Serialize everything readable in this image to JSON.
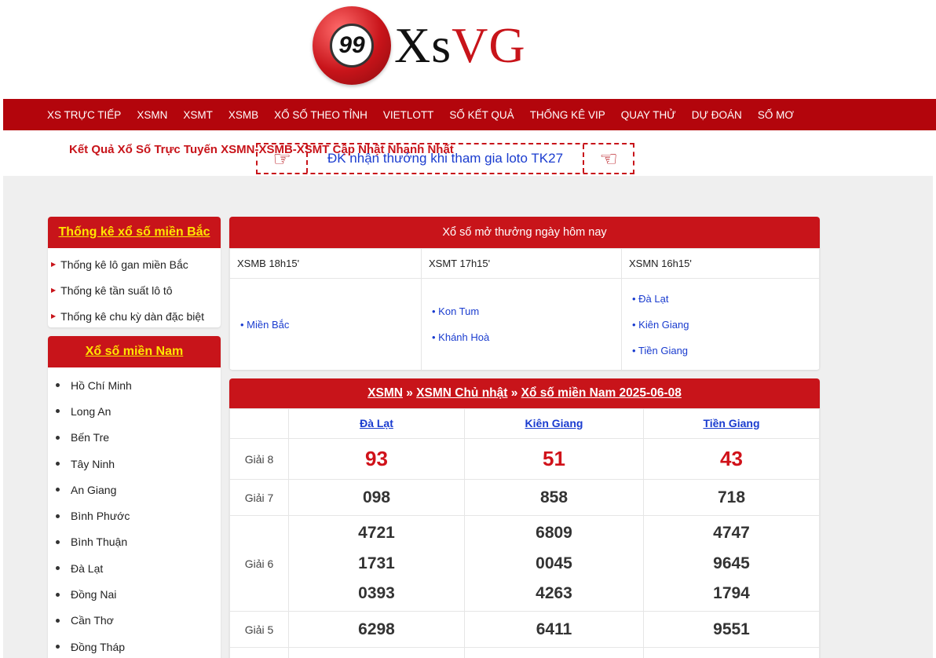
{
  "logo": {
    "badge_text": "99",
    "text_part1": "Xs",
    "text_part2": "VG"
  },
  "nav": {
    "items": [
      "XS TRỰC TIẾP",
      "XSMN",
      "XSMT",
      "XSMB",
      "XỔ SỐ THEO TỈNH",
      "VIETLOTT",
      "SỐ KẾT QUẢ",
      "THỐNG KÊ VIP",
      "QUAY THỬ",
      "DỰ ĐOÁN",
      "SỐ MƠ"
    ]
  },
  "marquee": {
    "text": "Kết Quả Xổ Số Trực Tuyến XSMN-XSMB-XSMT Cập Nhật Nhanh Nhất",
    "promo_link": "ĐK nhận thưởng khi tham gia loto TK27"
  },
  "sidebar_north": {
    "title": "Thống kê xổ số miền Bắc",
    "items": [
      "Thống kê lô gan miền Bắc",
      "Thống kê tần suất lô tô",
      "Thống kê chu kỳ dàn đặc biệt"
    ]
  },
  "sidebar_south": {
    "title": "Xổ số miền Nam",
    "items": [
      "Hồ Chí Minh",
      "Long An",
      "Bến Tre",
      "Tây Ninh",
      "An Giang",
      "Bình Phước",
      "Bình Thuận",
      "Đà Lạt",
      "Đồng Nai",
      "Cần Thơ",
      "Đồng Tháp"
    ]
  },
  "today": {
    "title": "Xổ số mở thưởng ngày hôm nay",
    "columns": [
      {
        "header": "XSMB 18h15'",
        "links": [
          "• Miền Bắc"
        ]
      },
      {
        "header": "XSMT 17h15'",
        "links": [
          "• Kon Tum",
          "• Khánh Hoà"
        ]
      },
      {
        "header": "XSMN 16h15'",
        "links": [
          "• Đà Lạt",
          "• Kiên Giang",
          "• Tiền Giang"
        ]
      }
    ]
  },
  "result": {
    "breadcrumb": {
      "part1": "XSMN",
      "sep1": " » ",
      "part2": "XSMN Chủ nhật",
      "sep2": " » ",
      "part3": "Xổ số miền Nam 2025-06-08"
    },
    "provinces": [
      "Đà Lạt",
      "Kiên Giang",
      "Tiền Giang"
    ],
    "prizes": [
      {
        "label": "Giải 8",
        "values": [
          [
            "93"
          ],
          [
            "51"
          ],
          [
            "43"
          ]
        ]
      },
      {
        "label": "Giải 7",
        "values": [
          [
            "098"
          ],
          [
            "858"
          ],
          [
            "718"
          ]
        ]
      },
      {
        "label": "Giải 6",
        "values": [
          [
            "4721",
            "1731",
            "0393"
          ],
          [
            "6809",
            "0045",
            "4263"
          ],
          [
            "4747",
            "9645",
            "1794"
          ]
        ]
      },
      {
        "label": "Giải 5",
        "values": [
          [
            "6298"
          ],
          [
            "6411"
          ],
          [
            "9551"
          ]
        ]
      }
    ]
  },
  "colors": {
    "brand_red": "#c8141a",
    "nav_red": "#b3050c",
    "link_blue": "#1a3ccf",
    "yellow_title": "#ffe600"
  }
}
